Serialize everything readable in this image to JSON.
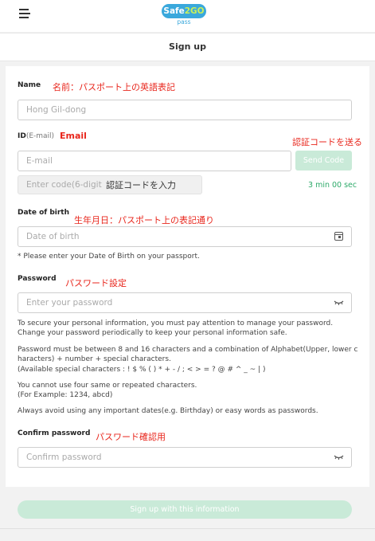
{
  "header": {
    "logo_main_a": "Safe",
    "logo_main_b": "2GO",
    "logo_sub": "pass"
  },
  "page_title": "Sign up",
  "name_section": {
    "label": "Name",
    "note": "名前：パスポート上の英語表記",
    "placeholder": "Hong Gil-dong"
  },
  "id_section": {
    "label": "ID",
    "label_suffix": "(E-mail)",
    "note": "Email",
    "note_send": "認証コードを送る",
    "placeholder": "E-mail",
    "send_button": "Send Code",
    "code_placeholder": "Enter code(6-digit",
    "code_note": "認証コードを入力",
    "timer": "3 min 00 sec"
  },
  "dob_section": {
    "label": "Date of birth",
    "note": "生年月日：パスポート上の表記通り",
    "placeholder": "Date of birth",
    "hint": "* Please enter your Date of Birth on your passport."
  },
  "password_section": {
    "label": "Password",
    "note": "パスワード設定",
    "placeholder": "Enter your password",
    "rules": [
      "To secure your personal information, you must pay attention to manage your password.",
      "Change your password periodically to keep your personal information safe.",
      "Password must be between 8 and 16 characters and a combination of Alphabet(Upper, lower c",
      "haracters) + number + special characters.",
      "(Available special characters : ! $ % ( ) * + - / ; < > = ? @ # ^ _ ~ | )",
      "You cannot use four same or repeated characters.",
      "(For Example: 1234, abcd)",
      "Always avoid using any important dates(e.g. Birthday) or easy words as passwords."
    ]
  },
  "confirm_section": {
    "label": "Confirm password",
    "note": "パスワード確認用",
    "placeholder": "Confirm password"
  },
  "signup_button": "Sign up with this information",
  "icons": {
    "menu": "hamburger-menu-icon",
    "calendar": "calendar-icon",
    "eye": "eye-closed-icon"
  },
  "colors": {
    "brand_blue": "#3aa8dc",
    "brand_green": "#c9ef5a",
    "annotation_red": "#e8261c",
    "timer_green": "#2eaa6a",
    "disabled_button": "#c9ead8"
  }
}
